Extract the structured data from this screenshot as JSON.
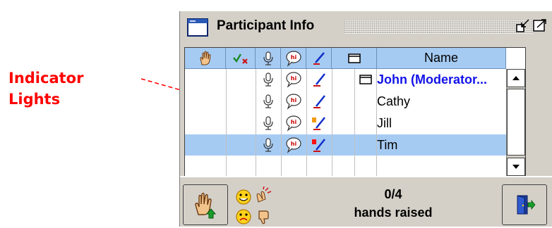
{
  "annotation": {
    "line1": "Indicator",
    "line2": "Lights",
    "color": "#ff0000"
  },
  "window": {
    "title": "Participant Info",
    "icon": "window-icon",
    "buttons": [
      "minimize-icon",
      "maximize-icon"
    ]
  },
  "table": {
    "columns": [
      {
        "icon": "hand-raise-icon"
      },
      {
        "icon": "check-x-icon"
      },
      {
        "icon": "microphone-icon"
      },
      {
        "icon": "chat-bubble-icon"
      },
      {
        "icon": "pen-icon"
      },
      {
        "icon": "whiteboard-icon"
      },
      {
        "label": "Name"
      }
    ],
    "rows": [
      {
        "name": "John (Moderator...",
        "moderator": true,
        "indicator": null,
        "selected": false
      },
      {
        "name": "Cathy",
        "moderator": false,
        "indicator": null,
        "selected": false
      },
      {
        "name": "Jill",
        "moderator": false,
        "indicator": "#f39a12",
        "selected": false
      },
      {
        "name": "Tim",
        "moderator": false,
        "indicator": "#ff1111",
        "selected": true
      }
    ]
  },
  "status": {
    "count": "0/4",
    "label": "hands raised"
  },
  "colors": {
    "header": "#a6cbf3",
    "selection": "#a6cbf3",
    "moderator": "#1212e8",
    "panel": "#d4d0c8"
  }
}
